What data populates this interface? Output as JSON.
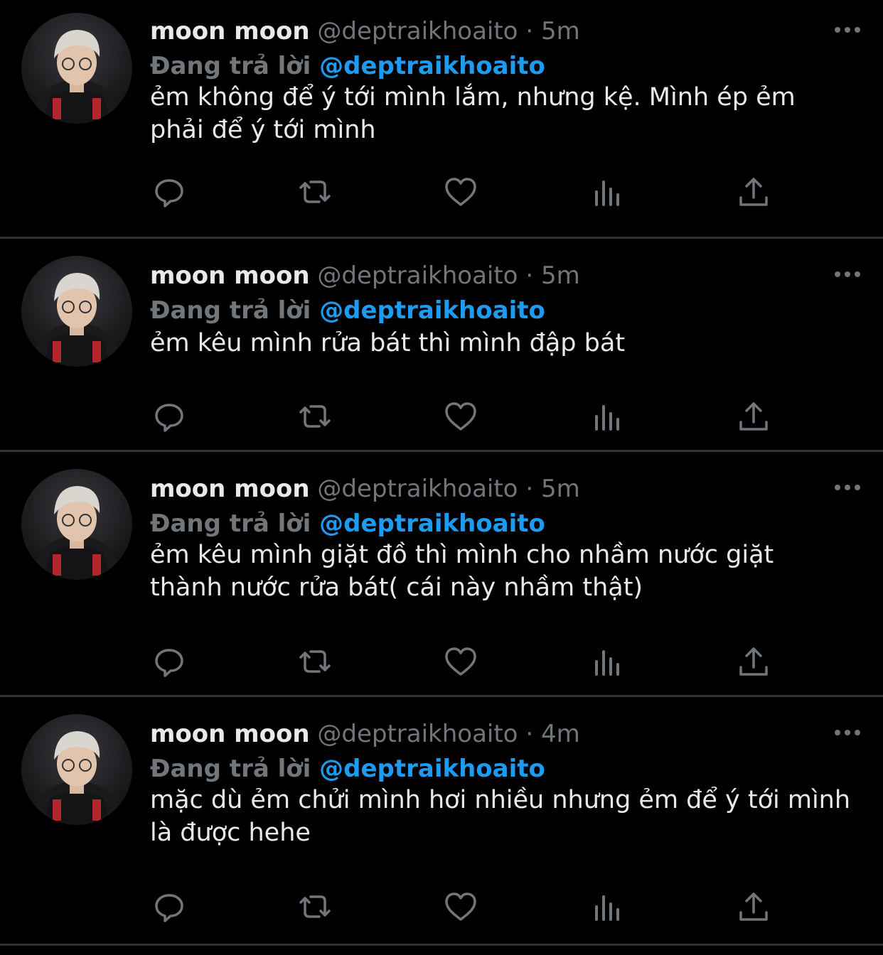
{
  "tweets": [
    {
      "name": "moon moon",
      "handle": "@deptraikhoaito",
      "dot": "·",
      "time": "5m",
      "replying_label": "Đang trả lời",
      "replying_to": "@deptraikhoaito",
      "text": "ẻm không để ý tới mình lắm, nhưng kệ. Mình ép ẻm phải để ý tới mình"
    },
    {
      "name": "moon moon",
      "handle": "@deptraikhoaito",
      "dot": "·",
      "time": "5m",
      "replying_label": "Đang trả lời",
      "replying_to": "@deptraikhoaito",
      "text": "ẻm kêu mình rửa bát thì mình đập bát"
    },
    {
      "name": "moon moon",
      "handle": "@deptraikhoaito",
      "dot": "·",
      "time": "5m",
      "replying_label": "Đang trả lời",
      "replying_to": "@deptraikhoaito",
      "text": "ẻm kêu mình giặt đồ thì mình cho nhầm nước giặt thành nước rửa bát( cái này nhầm thật)"
    },
    {
      "name": "moon moon",
      "handle": "@deptraikhoaito",
      "dot": "·",
      "time": "4m",
      "replying_label": "Đang trả lời",
      "replying_to": "@deptraikhoaito",
      "text": "mặc dù ẻm chửi mình hơi nhiều nhưng ẻm để ý tới mình là được hehe"
    }
  ],
  "icons": {
    "reply": "reply-icon",
    "retweet": "retweet-icon",
    "like": "heart-icon",
    "analytics": "analytics-icon",
    "share": "share-icon",
    "more": "more-icon"
  },
  "colors": {
    "background": "#000000",
    "text": "#e7e9ea",
    "secondary": "#71767b",
    "link": "#1d9bf0",
    "divider": "#2f3336"
  }
}
